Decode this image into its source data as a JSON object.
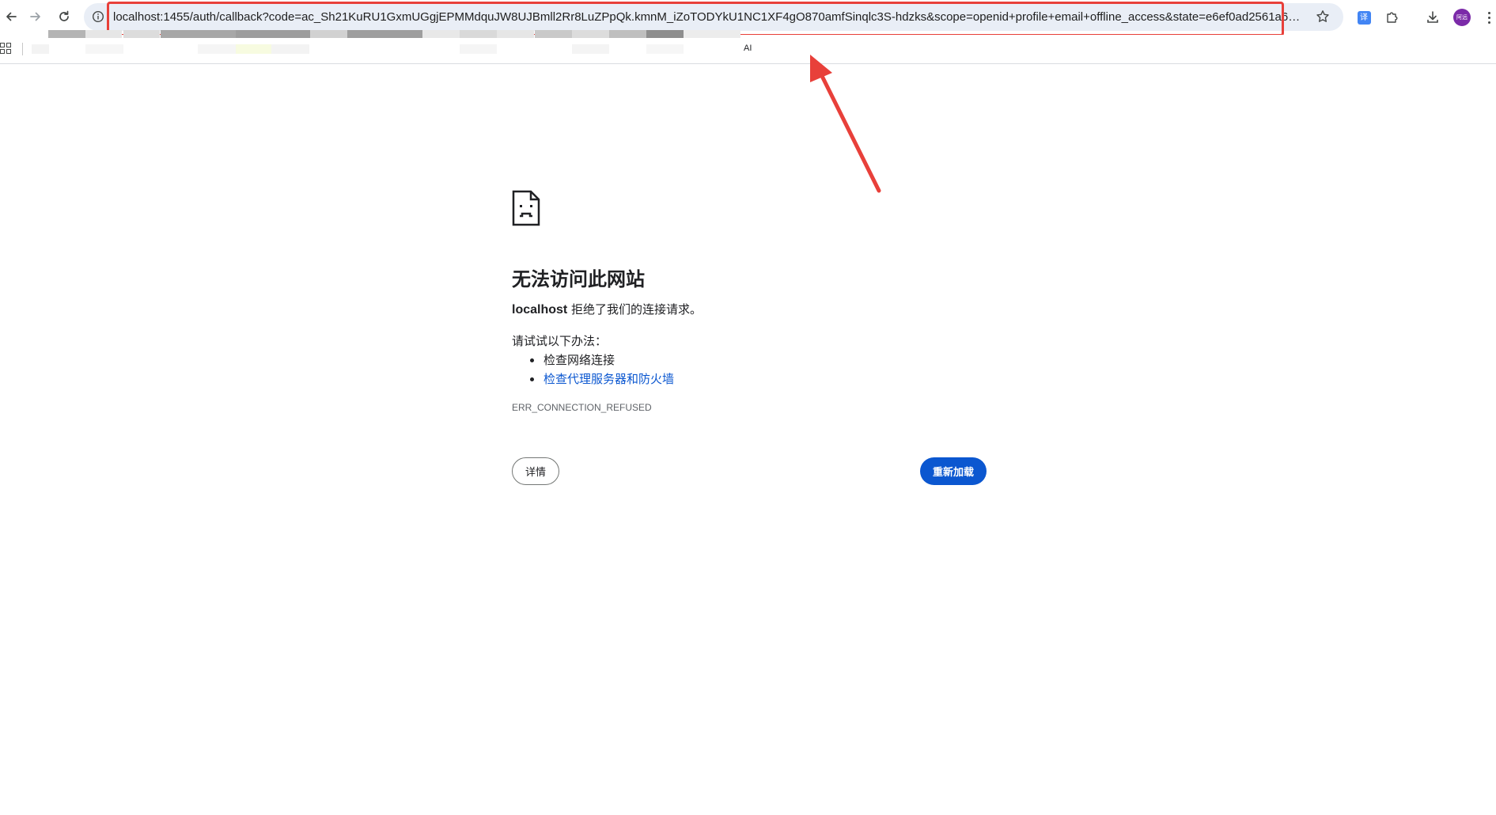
{
  "browser": {
    "url": "localhost:1455/auth/callback?code=ac_Sh21KuRU1GxmUGgjEPMMdquJW8UJBmll2Rr8LuZPpQk.kmnM_iZoTODYkU1NC1XF4gO870amfSinqlc3S-hdzks&scope=openid+profile+email+offline_access&state=e6ef0ad2561a66dbe...",
    "translate_badge": "译",
    "avatar_label": "阿远",
    "icons": {
      "back": "back-arrow-icon",
      "forward": "forward-arrow-icon",
      "reload": "reload-icon",
      "site_info": "info-icon",
      "bookmark": "star-icon",
      "extensions": "puzzle-icon",
      "downloads": "download-icon",
      "menu": "more-vert-icon"
    }
  },
  "bookmarks_bar": {
    "ai_label": "AI"
  },
  "error": {
    "title": "无法访问此网站",
    "host": "localhost",
    "message": " 拒绝了我们的连接请求。",
    "suggest_heading": "请试试以下办法：",
    "suggestions": [
      "检查网络连接",
      "检查代理服务器和防火墙"
    ],
    "code": "ERR_CONNECTION_REFUSED",
    "details_label": "详情",
    "reload_label": "重新加载"
  },
  "colors": {
    "annotation_red": "#e8403a",
    "primary_blue": "#0b57d0",
    "link_blue": "#0b57d0",
    "omnibox_bg": "#e9eef6"
  }
}
